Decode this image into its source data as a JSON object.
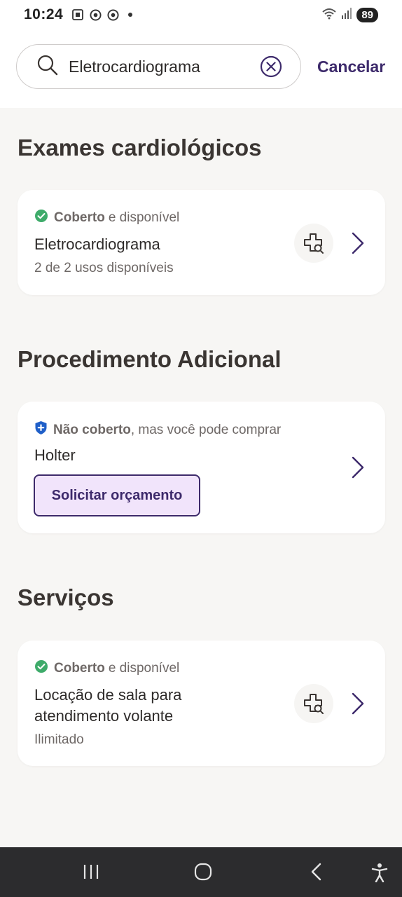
{
  "status_bar": {
    "time": "10:24",
    "battery": "89",
    "icons": [
      "screenshot-icon",
      "chrome-icon",
      "chrome-icon",
      "dot-icon",
      "wifi-icon",
      "signal-icon"
    ]
  },
  "search": {
    "value": "Eletrocardiograma",
    "cancel_label": "Cancelar"
  },
  "sections": [
    {
      "title": "Exames cardiológicos",
      "cards": [
        {
          "status_bold": "Coberto",
          "status_rest": "e disponível",
          "status_color": "#3eab6a",
          "title": "Eletrocardiograma",
          "subtitle": "2 de 2 usos disponíveis",
          "icon": "medical-search-icon"
        }
      ]
    },
    {
      "title": "Procedimento Adicional",
      "cards": [
        {
          "status_bold": "Não coberto",
          "status_rest": ", mas você pode comprar",
          "status_color": "#1f5fc8",
          "title": "Holter",
          "button_label": "Solicitar orçamento"
        }
      ]
    },
    {
      "title": "Serviços",
      "cards": [
        {
          "status_bold": "Coberto",
          "status_rest": "e disponível",
          "status_color": "#3eab6a",
          "title_line1": "Locação de sala para",
          "title_line2": "atendimento volante",
          "subtitle": "Ilimitado",
          "icon": "medical-search-icon"
        }
      ]
    }
  ],
  "colors": {
    "accent": "#3d2a6b",
    "button_bg": "#f1e4fb",
    "background": "#f7f6f4"
  }
}
